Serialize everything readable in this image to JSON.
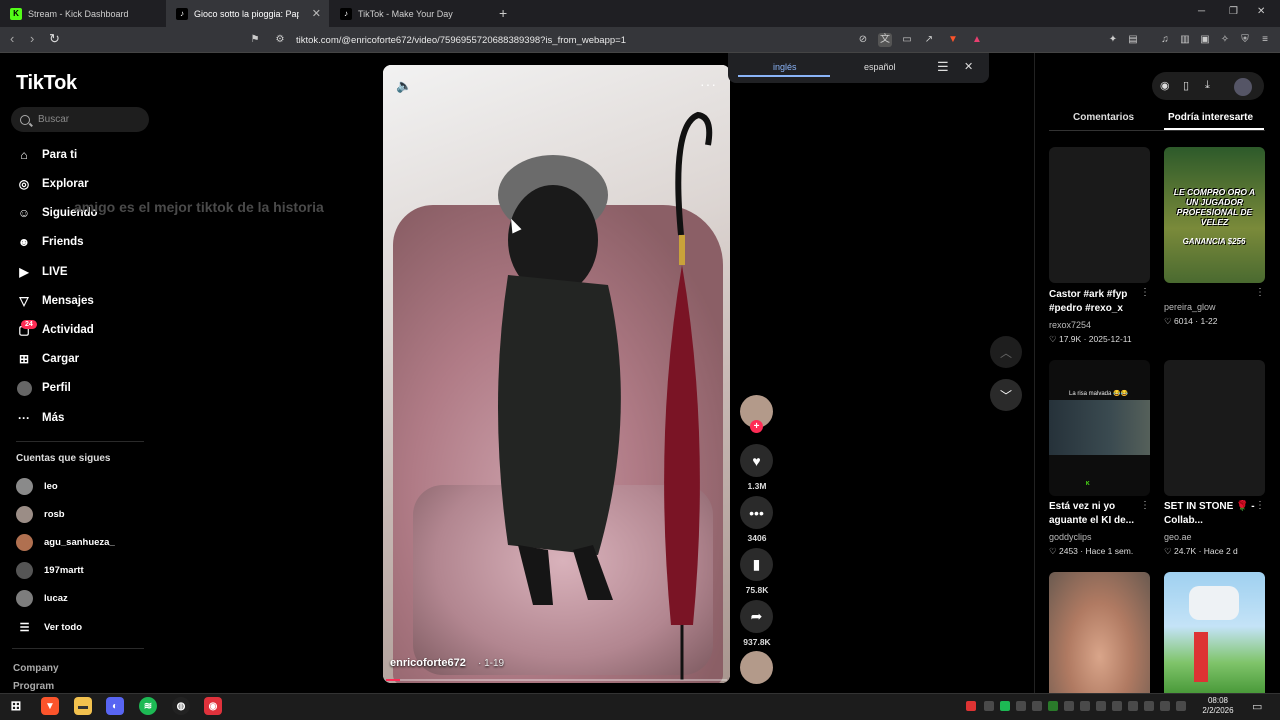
{
  "browser": {
    "tabs": [
      {
        "label": "Stream - Kick Dashboard",
        "icon": "kick-icon",
        "active": false
      },
      {
        "label": "Gioco sotto la pioggia: Papà …",
        "icon": "tiktok-icon",
        "active": true
      },
      {
        "label": "TikTok - Make Your Day",
        "icon": "tiktok-icon",
        "active": false
      }
    ],
    "new_tab": "+",
    "window_controls": {
      "minimize": "─",
      "restore": "❐",
      "close": "✕"
    },
    "url": "tiktok.com/@enricoforte672/video/7596955720688389398?is_from_webapp=1"
  },
  "translate": {
    "source": "inglés",
    "target": "español"
  },
  "sidebar": {
    "logo": "TikTok",
    "search_placeholder": "Buscar",
    "nav": [
      {
        "label": "Para ti",
        "icon": "home-icon"
      },
      {
        "label": "Explorar",
        "icon": "compass-icon"
      },
      {
        "label": "Siguiendo",
        "icon": "following-icon"
      },
      {
        "label": "Friends",
        "icon": "friends-icon"
      },
      {
        "label": "LIVE",
        "icon": "live-icon"
      },
      {
        "label": "Mensajes",
        "icon": "messages-icon"
      },
      {
        "label": "Actividad",
        "icon": "activity-icon"
      },
      {
        "label": "Cargar",
        "icon": "upload-icon"
      },
      {
        "label": "Perfil",
        "icon": "profile-icon"
      },
      {
        "label": "Más",
        "icon": "more-icon"
      }
    ],
    "activity_badge": "24",
    "following_title": "Cuentas que sigues",
    "following": [
      "leo",
      "rosb",
      "agu_sanhueza_",
      "197martt",
      "lucaz"
    ],
    "see_all": "Ver todo",
    "footer": [
      "Company",
      "Program"
    ]
  },
  "overlay_caption": "amigo es el mejor tiktok de la historia",
  "video": {
    "author": "enricoforte672",
    "date": "· 1-19",
    "progress": 0.04
  },
  "actions": {
    "likes": "1.3M",
    "comments": "3406",
    "saves": "75.8K",
    "shares": "937.8K"
  },
  "right_panel": {
    "tabs": [
      "Comentarios",
      "Podría interesarte"
    ],
    "cards": [
      {
        "title": "Castor #ark #fyp #pedro #rexo_x",
        "user": "rexox7254",
        "likes": "17.9K",
        "date": "2025-12-11",
        "thumb": "blank"
      },
      {
        "title": "",
        "user": "pereira_glow",
        "likes": "6014",
        "date": "1-22",
        "thumb": "text",
        "thumb_text": "LE COMPRO ORO A UN JUGADOR PROFESIONAL DE VELEZ",
        "thumb_sub": "GANANCIA $256"
      },
      {
        "title": "Está vez ni yo aguante el KI de...",
        "user": "goddyclips",
        "likes": "2453",
        "date": "Hace 1 sem.",
        "thumb": "screen",
        "thumb_text": "La risa malvada 😂😂"
      },
      {
        "title": "SET IN STONE 🌹 - Collab...",
        "user": "geo.ae",
        "likes": "24.7K",
        "date": "Hace 2 d",
        "thumb": "blank"
      },
      {
        "title": "",
        "user": "",
        "likes": "",
        "date": "",
        "thumb": "face"
      },
      {
        "title": "",
        "user": "",
        "likes": "",
        "date": "",
        "thumb": "game"
      }
    ]
  },
  "taskbar": {
    "time": "08:08",
    "date": "2/2/2026"
  }
}
